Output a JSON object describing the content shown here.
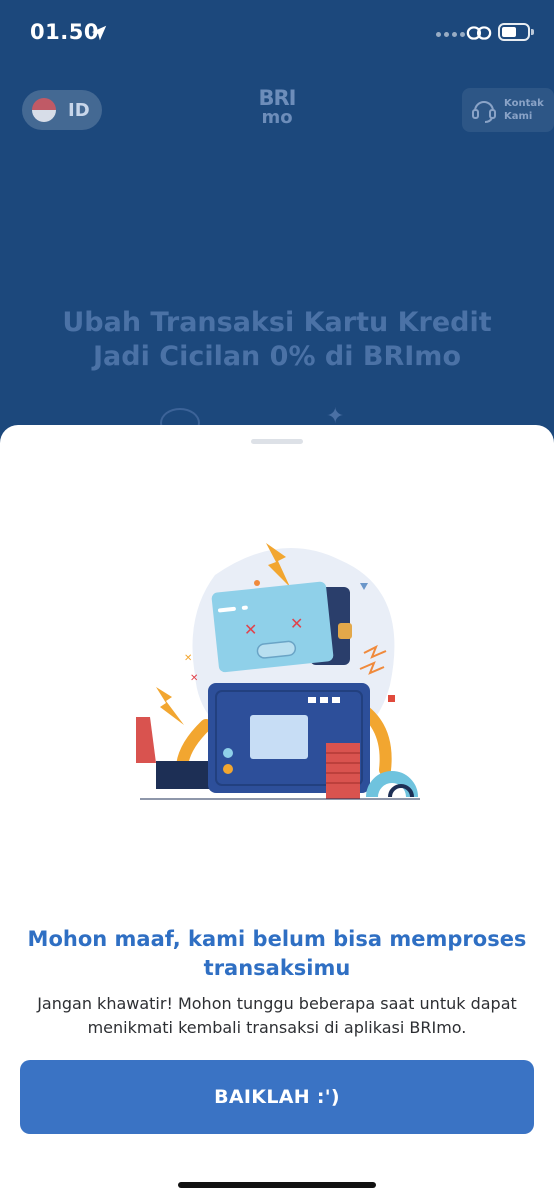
{
  "status_bar": {
    "time": "01.50"
  },
  "background_app": {
    "language_code": "ID",
    "brand_line1": "BRI",
    "brand_line2": "mo",
    "contact_line1": "Kontak",
    "contact_line2": "Kami",
    "promo_title": "Ubah Transaksi Kartu Kredit Jadi Cicilan 0% di BRImo"
  },
  "dialog": {
    "title": "Mohon maaf, kami belum bisa memproses transaksimu",
    "description": "Jangan khawatir! Mohon tunggu beberapa saat untuk dapat menikmati kembali transaksi di aplikasi BRImo.",
    "confirm_label": "BAIKLAH :')",
    "illustration": "broken-robot-illustration"
  },
  "colors": {
    "background_app": "#1f4f86",
    "accent": "#3a73c4",
    "title": "#2f6fc3",
    "text": "#2d2f33"
  }
}
